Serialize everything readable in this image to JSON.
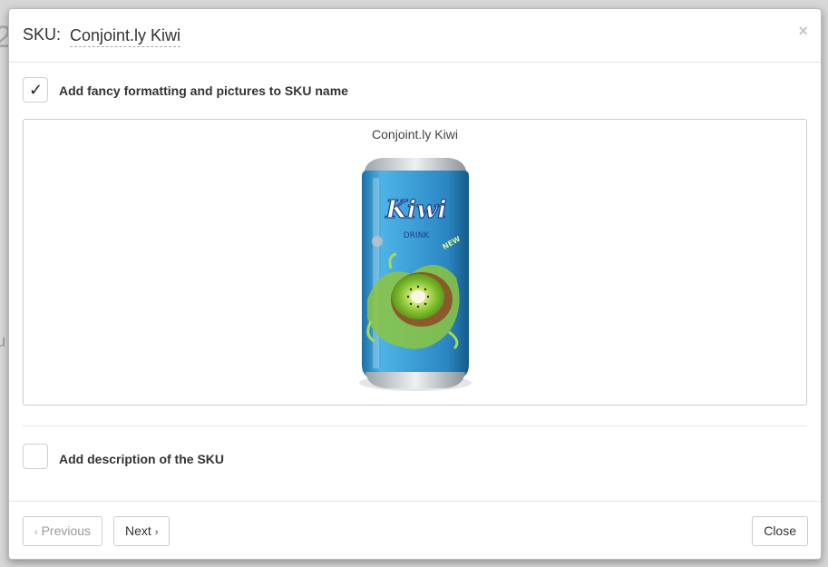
{
  "header": {
    "prefix": "SKU:",
    "sku_name": "Conjoint.ly Kiwi",
    "close_symbol": "×"
  },
  "fancy_formatting": {
    "label": "Add fancy formatting and pictures to SKU name",
    "checked": true,
    "check_glyph": "✓"
  },
  "preview": {
    "title": "Conjoint.ly Kiwi",
    "image_text": {
      "brand": "Kiwi",
      "subtitle": "DRINK",
      "badge": "NEW"
    }
  },
  "description": {
    "label": "Add description of the SKU",
    "checked": false
  },
  "footer": {
    "previous_label": "Previous",
    "next_label": "Next",
    "close_label": "Close",
    "prev_icon": "‹",
    "next_icon": "›"
  },
  "colors": {
    "can_blue": "#3ea1d8",
    "can_dark": "#1c6fa6",
    "kiwi_green": "#8cc63f",
    "kiwi_brown": "#8b5a2b",
    "brand_text": "#1f3f8f"
  }
}
